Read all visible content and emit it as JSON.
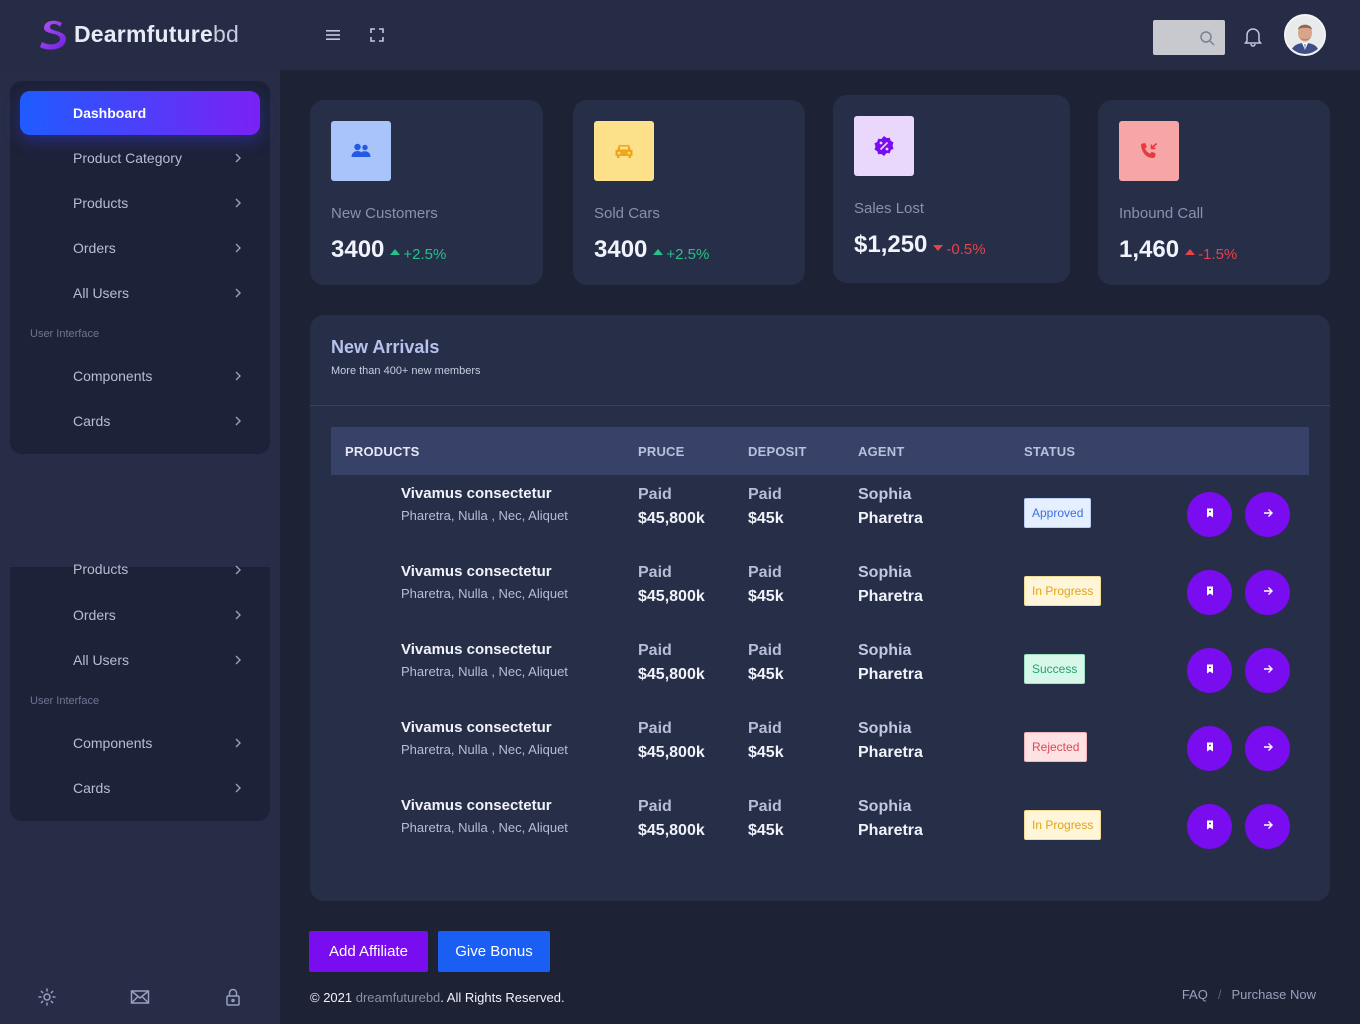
{
  "brand": {
    "name_bold": "Dearmfuture",
    "name_light": "bd"
  },
  "colors": {
    "background": "#1d2235",
    "panel": "#272e48",
    "accent_purple": "#7a0cf0",
    "accent_blue": "#1a5ef4",
    "positive": "#25c28a",
    "negative": "#e5434a"
  },
  "topbar": {
    "icons": [
      "menu-icon",
      "fullscreen-icon",
      "search-icon",
      "bell-icon",
      "user-avatar"
    ]
  },
  "sidebar": {
    "panel1": {
      "items": [
        {
          "label": "Dashboard",
          "active": true
        },
        {
          "label": "Product Category"
        },
        {
          "label": "Products"
        },
        {
          "label": "Orders"
        },
        {
          "label": "All Users"
        }
      ],
      "section": "User Interface",
      "section_items": [
        {
          "label": "Components"
        },
        {
          "label": "Cards"
        }
      ]
    },
    "panel2": {
      "items": [
        {
          "label": "Products"
        },
        {
          "label": "Orders"
        },
        {
          "label": "All Users"
        }
      ],
      "section": "User Interface",
      "section_items": [
        {
          "label": "Components"
        },
        {
          "label": "Cards"
        }
      ]
    },
    "footer_icons": [
      "settings-icon",
      "mail-icon",
      "lock-icon"
    ]
  },
  "stats": [
    {
      "label": "New Customers",
      "value": "3400",
      "trend": "+2.5%",
      "direction": "up",
      "icon": "users-icon",
      "icon_bg": "#a9c3fb"
    },
    {
      "label": "Sold Cars",
      "value": "3400",
      "trend": "+2.5%",
      "direction": "up",
      "icon": "car-icon",
      "icon_bg": "#fde08a"
    },
    {
      "label": "Sales Lost",
      "value": "$1,250",
      "trend": "-0.5%",
      "direction": "down",
      "icon": "discount-badge-icon",
      "icon_bg": "#e9d8fb"
    },
    {
      "label": "Inbound Call",
      "value": "1,460",
      "trend": "-1.5%",
      "direction": "up-negative",
      "icon": "incoming-call-icon",
      "icon_bg": "#f6a6a6"
    }
  ],
  "arrivals": {
    "title": "New Arrivals",
    "subtitle": "More than 400+ new members",
    "columns": [
      "PRODUCTS",
      "PRUCE",
      "DEPOSIT",
      "AGENT",
      "STATUS"
    ],
    "rows": [
      {
        "name": "Vivamus consectetur",
        "tags": "Pharetra, Nulla , Nec, Aliquet",
        "price_label": "Paid",
        "price": "$45,800k",
        "deposit_label": "Paid",
        "deposit": "$45k",
        "agent_first": "Sophia",
        "agent_last": "Pharetra",
        "status": "Approved"
      },
      {
        "name": "Vivamus consectetur",
        "tags": "Pharetra, Nulla , Nec, Aliquet",
        "price_label": "Paid",
        "price": "$45,800k",
        "deposit_label": "Paid",
        "deposit": "$45k",
        "agent_first": "Sophia",
        "agent_last": "Pharetra",
        "status": "In Progress"
      },
      {
        "name": "Vivamus consectetur",
        "tags": "Pharetra, Nulla , Nec, Aliquet",
        "price_label": "Paid",
        "price": "$45,800k",
        "deposit_label": "Paid",
        "deposit": "$45k",
        "agent_first": "Sophia",
        "agent_last": "Pharetra",
        "status": "Success"
      },
      {
        "name": "Vivamus consectetur",
        "tags": "Pharetra, Nulla , Nec, Aliquet",
        "price_label": "Paid",
        "price": "$45,800k",
        "deposit_label": "Paid",
        "deposit": "$45k",
        "agent_first": "Sophia",
        "agent_last": "Pharetra",
        "status": "Rejected"
      },
      {
        "name": "Vivamus consectetur",
        "tags": "Pharetra, Nulla , Nec, Aliquet",
        "price_label": "Paid",
        "price": "$45,800k",
        "deposit_label": "Paid",
        "deposit": "$45k",
        "agent_first": "Sophia",
        "agent_last": "Pharetra",
        "status": "In Progress"
      }
    ],
    "status_styles": {
      "Approved": {
        "bg": "#e6efff",
        "fg": "#3b6fe0",
        "border": "#b9cdf7"
      },
      "In Progress": {
        "bg": "#fff5d9",
        "fg": "#e0a418",
        "border": "#f6dc93"
      },
      "Success": {
        "bg": "#d7f7e8",
        "fg": "#1ea56d",
        "border": "#9fe3c4"
      },
      "Rejected": {
        "bg": "#fde1e3",
        "fg": "#d94b55",
        "border": "#f5b5ba"
      }
    }
  },
  "buttons": {
    "affiliate": "Add Affiliate",
    "bonus": "Give Bonus"
  },
  "footer": {
    "copyright_prefix": "© 2021 ",
    "copyright_link": "dreamfuturebd",
    "copyright_suffix": ". All Rights Reserved.",
    "faq": "FAQ",
    "separator": "/",
    "purchase": "Purchase Now"
  }
}
